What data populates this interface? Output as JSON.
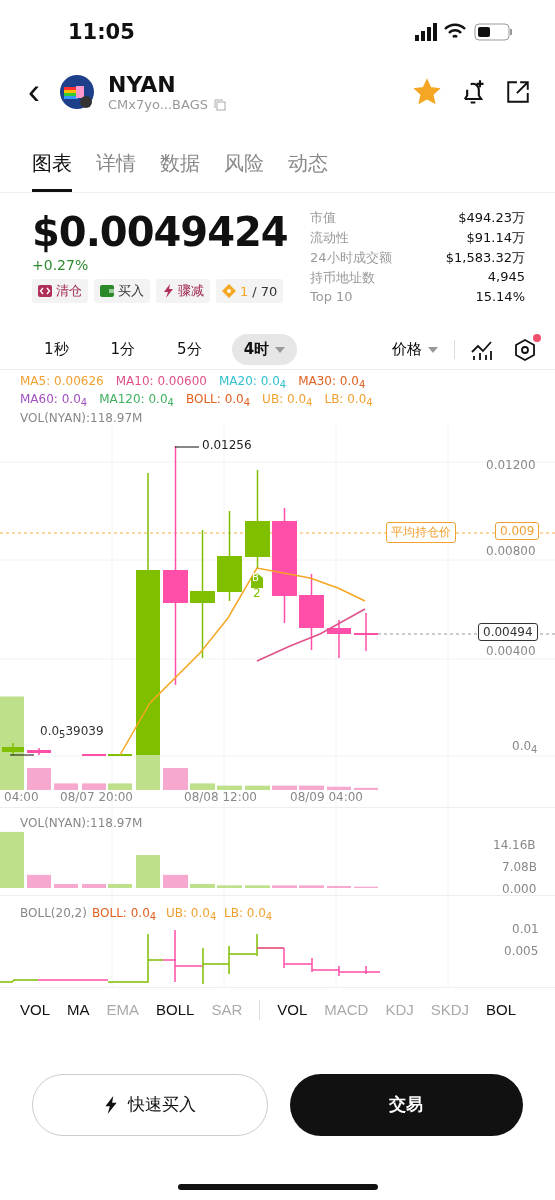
{
  "status_bar": {
    "time": "11:05"
  },
  "header": {
    "back": "‹",
    "name": "NYAN",
    "address": "CMx7yo...BAGS",
    "favorited": true
  },
  "tabs": [
    {
      "label": "图表",
      "selected": true
    },
    {
      "label": "详情",
      "selected": false
    },
    {
      "label": "数据",
      "selected": false
    },
    {
      "label": "风险",
      "selected": false
    },
    {
      "label": "动态",
      "selected": false
    }
  ],
  "price": {
    "value": "$0.0049424",
    "change": "+0.27%"
  },
  "chips": [
    {
      "kind": "clear",
      "label": "清仓"
    },
    {
      "kind": "buy",
      "label": "买入"
    },
    {
      "kind": "drop",
      "label": "骤减"
    },
    {
      "kind": "rank",
      "highlight": "1",
      "label": "/ 70"
    }
  ],
  "stats": [
    {
      "label": "市值",
      "value": "$494.23万"
    },
    {
      "label": "流动性",
      "value": "$91.14万"
    },
    {
      "label": "24小时成交额",
      "value": "$1,583.32万"
    },
    {
      "label": "持币地址数",
      "value": "4,945"
    },
    {
      "label": "Top 10",
      "value": "15.14%"
    }
  ],
  "timeframes": [
    {
      "label": "1秒",
      "selected": false
    },
    {
      "label": "1分",
      "selected": false
    },
    {
      "label": "5分",
      "selected": false
    },
    {
      "label": "4时",
      "selected": true
    }
  ],
  "price_selector": "价格",
  "settings_notification": true,
  "legend": [
    {
      "text": "MA5: 0.00626",
      "color": "#f0a030"
    },
    {
      "text": "MA10: 0.00600",
      "color": "#e0508a"
    },
    {
      "text": "MA20: 0.0$_{4}$",
      "color": "#30c0d0"
    },
    {
      "text": "MA30: 0.0$_{4}$",
      "color": "#e06020"
    },
    {
      "text": "MA60: 0.0$_{4}$",
      "color": "#a050c0"
    },
    {
      "text": "MA120: 0.0$_{4}$",
      "color": "#40b060"
    },
    {
      "text": "BOLL: 0.0$_{4}$",
      "color": "#e06020"
    },
    {
      "text": "UB: 0.0$_{4}$",
      "color": "#f0a030"
    },
    {
      "text": "LB: 0.0$_{4}$",
      "color": "#f0a030"
    }
  ],
  "volume_label": "VOL(NYAN):118.97M",
  "main_chart": {
    "high_label": "0.01256",
    "low_label": "0.0$_{5}$39039",
    "avg_tag": "平均持仓价",
    "avg_value": "0.009",
    "current_value": "0.00494",
    "buy_marker": "B",
    "buy_count": "2",
    "y_labels": [
      "0.01200",
      "0.00800",
      "0.00400",
      "0.0$_{4}$"
    ],
    "x_labels": [
      "04:00",
      "08/07 20:00",
      "08/08 12:00",
      "08/09 04:00"
    ]
  },
  "volume_panel": {
    "label": "VOL(NYAN):118.97M",
    "y_labels": [
      "14.16B",
      "7.08B",
      "0.000"
    ]
  },
  "boll_panel": {
    "title": "BOLL(20,2)",
    "items": [
      {
        "text": "BOLL: 0.0$_{4}$",
        "color": "#e06020"
      },
      {
        "text": "UB: 0.0$_{4}$",
        "color": "#f0a030"
      },
      {
        "text": "LB: 0.0$_{4}$",
        "color": "#f0a030"
      }
    ],
    "y_labels": [
      "0.01",
      "0.005"
    ]
  },
  "indicators": [
    {
      "label": "VOL",
      "selected": true,
      "kind": "item"
    },
    {
      "label": "MA",
      "selected": true,
      "kind": "item"
    },
    {
      "label": "EMA",
      "selected": false,
      "kind": "item"
    },
    {
      "label": "BOLL",
      "selected": true,
      "kind": "item"
    },
    {
      "label": "SAR",
      "selected": false,
      "kind": "item"
    },
    {
      "kind": "divider"
    },
    {
      "label": "VOL",
      "selected": true,
      "kind": "item"
    },
    {
      "label": "MACD",
      "selected": false,
      "kind": "item"
    },
    {
      "label": "KDJ",
      "selected": false,
      "kind": "item"
    },
    {
      "label": "SKDJ",
      "selected": false,
      "kind": "item"
    },
    {
      "label": "BOL",
      "selected": true,
      "kind": "item"
    }
  ],
  "buttons": {
    "quick_buy": "快速买入",
    "trade": "交易"
  }
}
